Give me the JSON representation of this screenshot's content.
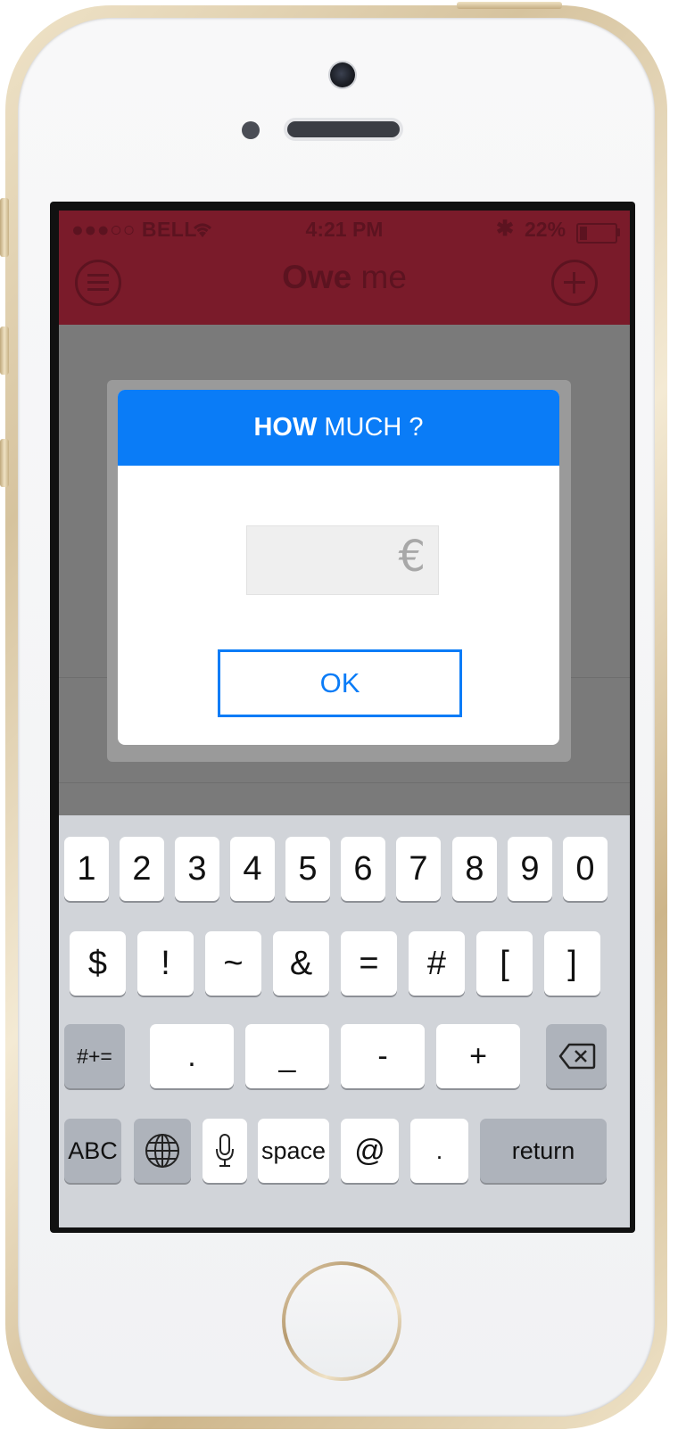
{
  "status_bar": {
    "carrier": "●●●○○ BELL",
    "time": "4:21 PM",
    "bluetooth": "✱",
    "battery_percent": "22%",
    "battery_level": 0.22
  },
  "nav": {
    "title_bold": "Owe",
    "title_light": " me",
    "menu_icon": "menu-icon",
    "add_icon": "plus-circle-icon",
    "bar_color": "#7a1b2a"
  },
  "dialog": {
    "title_bold": "HOW",
    "title_rest": " MUCH ?",
    "currency_symbol": "€",
    "amount_value": "",
    "ok_label": "OK",
    "accent_color": "#0a7cf7"
  },
  "keyboard": {
    "row1": [
      "1",
      "2",
      "3",
      "4",
      "5",
      "6",
      "7",
      "8",
      "9",
      "0"
    ],
    "row2": [
      "$",
      "!",
      "~",
      "&",
      "=",
      "#",
      "[",
      "]"
    ],
    "row3": {
      "shift_label": "#+=",
      "keys": [
        ".",
        "_",
        "-",
        "+"
      ],
      "backspace_icon": "backspace-icon"
    },
    "row4": {
      "abc_label": "ABC",
      "globe_icon": "globe-icon",
      "mic_icon": "microphone-icon",
      "space_label": "space",
      "at_label": "@",
      "dot_label": ".",
      "return_label": "return"
    }
  }
}
